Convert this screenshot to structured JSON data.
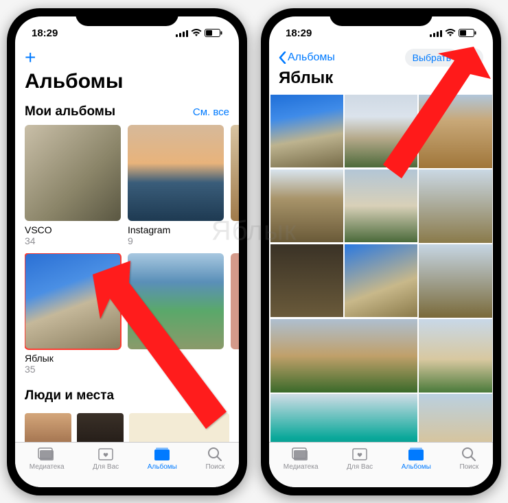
{
  "status": {
    "time": "18:29"
  },
  "watermark": "Яблык",
  "left": {
    "title": "Альбомы",
    "sections": {
      "myAlbums": {
        "title": "Мои альбомы",
        "seeAll": "См. все"
      },
      "peoplePlaces": {
        "title": "Люди и места"
      }
    },
    "albums": [
      {
        "name": "VSCO",
        "count": "34"
      },
      {
        "name": "Instagram",
        "count": "9"
      },
      {
        "name": "Яблык",
        "count": "35"
      }
    ]
  },
  "right": {
    "back": "Альбомы",
    "select": "Выбрать",
    "title": "Яблык"
  },
  "tabs": [
    {
      "label": "Медиатека"
    },
    {
      "label": "Для Вас"
    },
    {
      "label": "Альбомы"
    },
    {
      "label": "Поиск"
    }
  ]
}
